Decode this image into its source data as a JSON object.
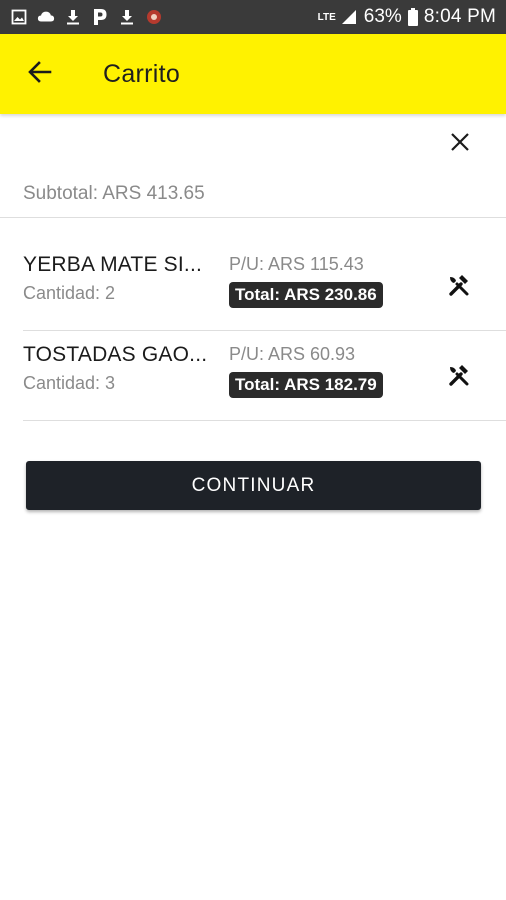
{
  "status_bar": {
    "battery_text": "63%",
    "time": "8:04 PM",
    "network": "LTE",
    "left_icons": [
      "image-icon",
      "cloud-icon",
      "download-icon",
      "parking-icon",
      "download-icon",
      "app-notification-icon"
    ]
  },
  "app_bar": {
    "title": "Carrito",
    "back_icon": "arrow-left-icon",
    "background_color": "#fff200"
  },
  "cart": {
    "close_icon": "close-icon",
    "subtotal_text": "Subtotal: ARS 413.65",
    "items": [
      {
        "name": "YERBA MATE SI...",
        "quantity_text": "Cantidad: 2",
        "unit_price_text": "P/U: ARS 115.43",
        "total_text": "Total: ARS 230.86",
        "edit_icon": "tools-icon"
      },
      {
        "name": "TOSTADAS GAO...",
        "quantity_text": "Cantidad: 3",
        "unit_price_text": "P/U: ARS 60.93",
        "total_text": "Total: ARS 182.79",
        "edit_icon": "tools-icon"
      }
    ],
    "continue_label": "CONTINUAR"
  }
}
